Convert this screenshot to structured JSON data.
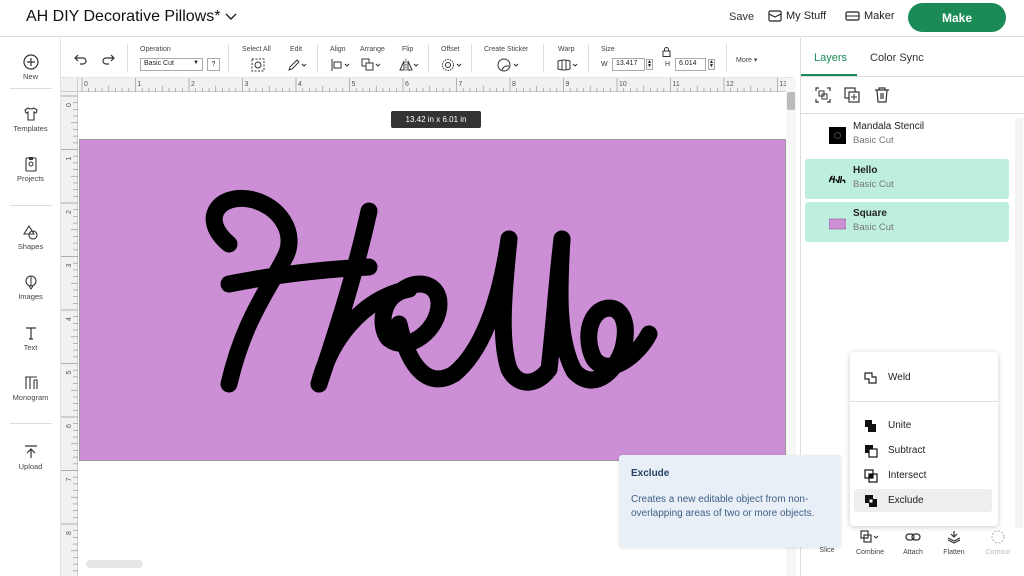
{
  "header": {
    "project_title": "AH DIY Decorative Pillows*",
    "save_label": "Save",
    "my_stuff_label": "My Stuff",
    "maker_label": "Maker",
    "make_label": "Make"
  },
  "left_rail": {
    "new": "New",
    "templates": "Templates",
    "projects": "Projects",
    "shapes": "Shapes",
    "images": "Images",
    "text": "Text",
    "monogram": "Monogram",
    "upload": "Upload"
  },
  "toolbar": {
    "operation_label": "Operation",
    "operation_value": "Basic Cut",
    "help": "?",
    "select_all": "Select All",
    "edit": "Edit",
    "align": "Align",
    "arrange": "Arrange",
    "flip": "Flip",
    "offset": "Offset",
    "create_sticker": "Create Sticker",
    "warp": "Warp",
    "size_label": "Size",
    "w_letter": "W",
    "w_value": "13.417",
    "h_letter": "H",
    "h_value": "6.014",
    "more": "More ▾"
  },
  "canvas": {
    "size_tooltip": "13.42  in x 6.01  in",
    "design_text": "Hello",
    "square_color": "#cc8fd6",
    "ruler_top": [
      "0",
      "1",
      "2",
      "3",
      "4",
      "5",
      "6",
      "7",
      "8",
      "9",
      "10",
      "11",
      "12",
      "13"
    ],
    "ruler_left": [
      "0",
      "1",
      "2",
      "3",
      "4",
      "5",
      "6",
      "7",
      "8"
    ]
  },
  "right_panel": {
    "tab_layers": "Layers",
    "tab_color_sync": "Color Sync",
    "layers": [
      {
        "name": "Mandala Stencil",
        "type": "Basic Cut"
      },
      {
        "name": "Hello",
        "type": "Basic Cut"
      },
      {
        "name": "Square",
        "type": "Basic Cut"
      }
    ]
  },
  "combine_menu": {
    "weld": "Weld",
    "unite": "Unite",
    "subtract": "Subtract",
    "intersect": "Intersect",
    "exclude": "Exclude"
  },
  "bottom_tools": {
    "slice": "Slice",
    "combine": "Combine",
    "attach": "Attach",
    "flatten": "Flatten",
    "contour": "Contour"
  },
  "exclude_tooltip": {
    "title": "Exclude",
    "body": "Creates a new editable object from non-overlapping areas of two or more objects."
  },
  "colors": {
    "accent": "#1a8a56",
    "selected_layer": "#bdeede",
    "tooltip_bg": "#e9eff6"
  }
}
